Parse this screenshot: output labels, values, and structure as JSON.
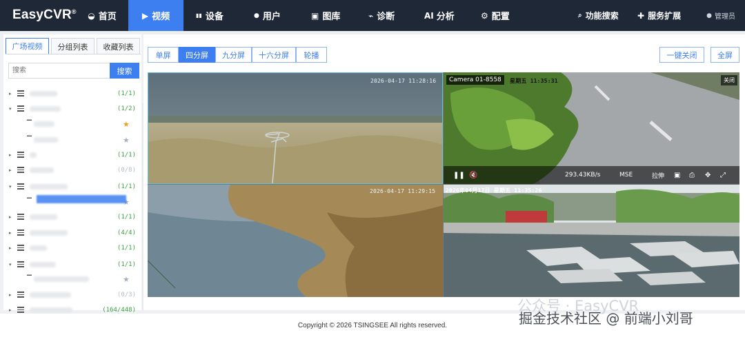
{
  "app": {
    "logo": "EasyCVR",
    "reg": "®"
  },
  "nav": [
    {
      "icon": "◒",
      "label": "首页"
    },
    {
      "icon": "▶",
      "label": "视频"
    },
    {
      "icon": "▮▮",
      "label": "设备"
    },
    {
      "icon": "●",
      "label": "用户"
    },
    {
      "icon": "▣",
      "label": "图库"
    },
    {
      "icon": "⌁",
      "label": "诊断"
    },
    {
      "icon": "AI",
      "label": "分析"
    },
    {
      "icon": "⚙",
      "label": "配置"
    }
  ],
  "nav_right": [
    {
      "icon": "🔍",
      "label": "功能搜索"
    },
    {
      "icon": "✚",
      "label": "服务扩展"
    }
  ],
  "user": {
    "icon": "●",
    "label": "管理员"
  },
  "sidebar": {
    "tabs": [
      "广场视频",
      "分组列表",
      "收藏列表"
    ],
    "search_placeholder": "搜索",
    "search_button": "搜索",
    "rows": [
      {
        "count": "(1/1)"
      },
      {
        "count": "(1/2)"
      },
      {
        "count": ""
      },
      {
        "count": ""
      },
      {
        "count": "(1/1)"
      },
      {
        "count": "(0/8)"
      },
      {
        "count": "(1/1)"
      },
      {
        "count": ""
      },
      {
        "count": "(1/1)"
      },
      {
        "count": "(4/4)"
      },
      {
        "count": "(1/1)"
      },
      {
        "count": "(1/1)"
      },
      {
        "count": ""
      },
      {
        "count": "(0/3)"
      },
      {
        "count": "(164/448)"
      }
    ]
  },
  "toolbar": {
    "layouts": [
      "单屏",
      "四分屏",
      "九分屏",
      "十六分屏",
      "轮播"
    ],
    "close_all": "一键关闭",
    "fullscreen": "全屏"
  },
  "tiles": [
    {
      "timestamp": "2026-04-17 11:28:16"
    },
    {
      "camera": "Camera 01-8558",
      "timestamp": "星期五 11:35:31",
      "close": "关闭",
      "bitrate": "293.43KB/s",
      "mode": "MSE",
      "stretch": "拉伸"
    },
    {
      "timestamp": "2026-04-17 11:29:15"
    },
    {
      "timestamp": "2026年04月17日 星期五 11:35:26"
    }
  ],
  "footer": {
    "copyright": "Copyright © 2026 TSINGSEE All rights reserved."
  },
  "watermark": {
    "line1": "公众号 · EasyCVR",
    "line2": "掘金技术社区 @ 前端小刘哥"
  },
  "colors": {
    "nav_bg": "#1e2837",
    "accent": "#3d7ef0",
    "count_green": "#3aa140",
    "star": "#f0a21b"
  }
}
